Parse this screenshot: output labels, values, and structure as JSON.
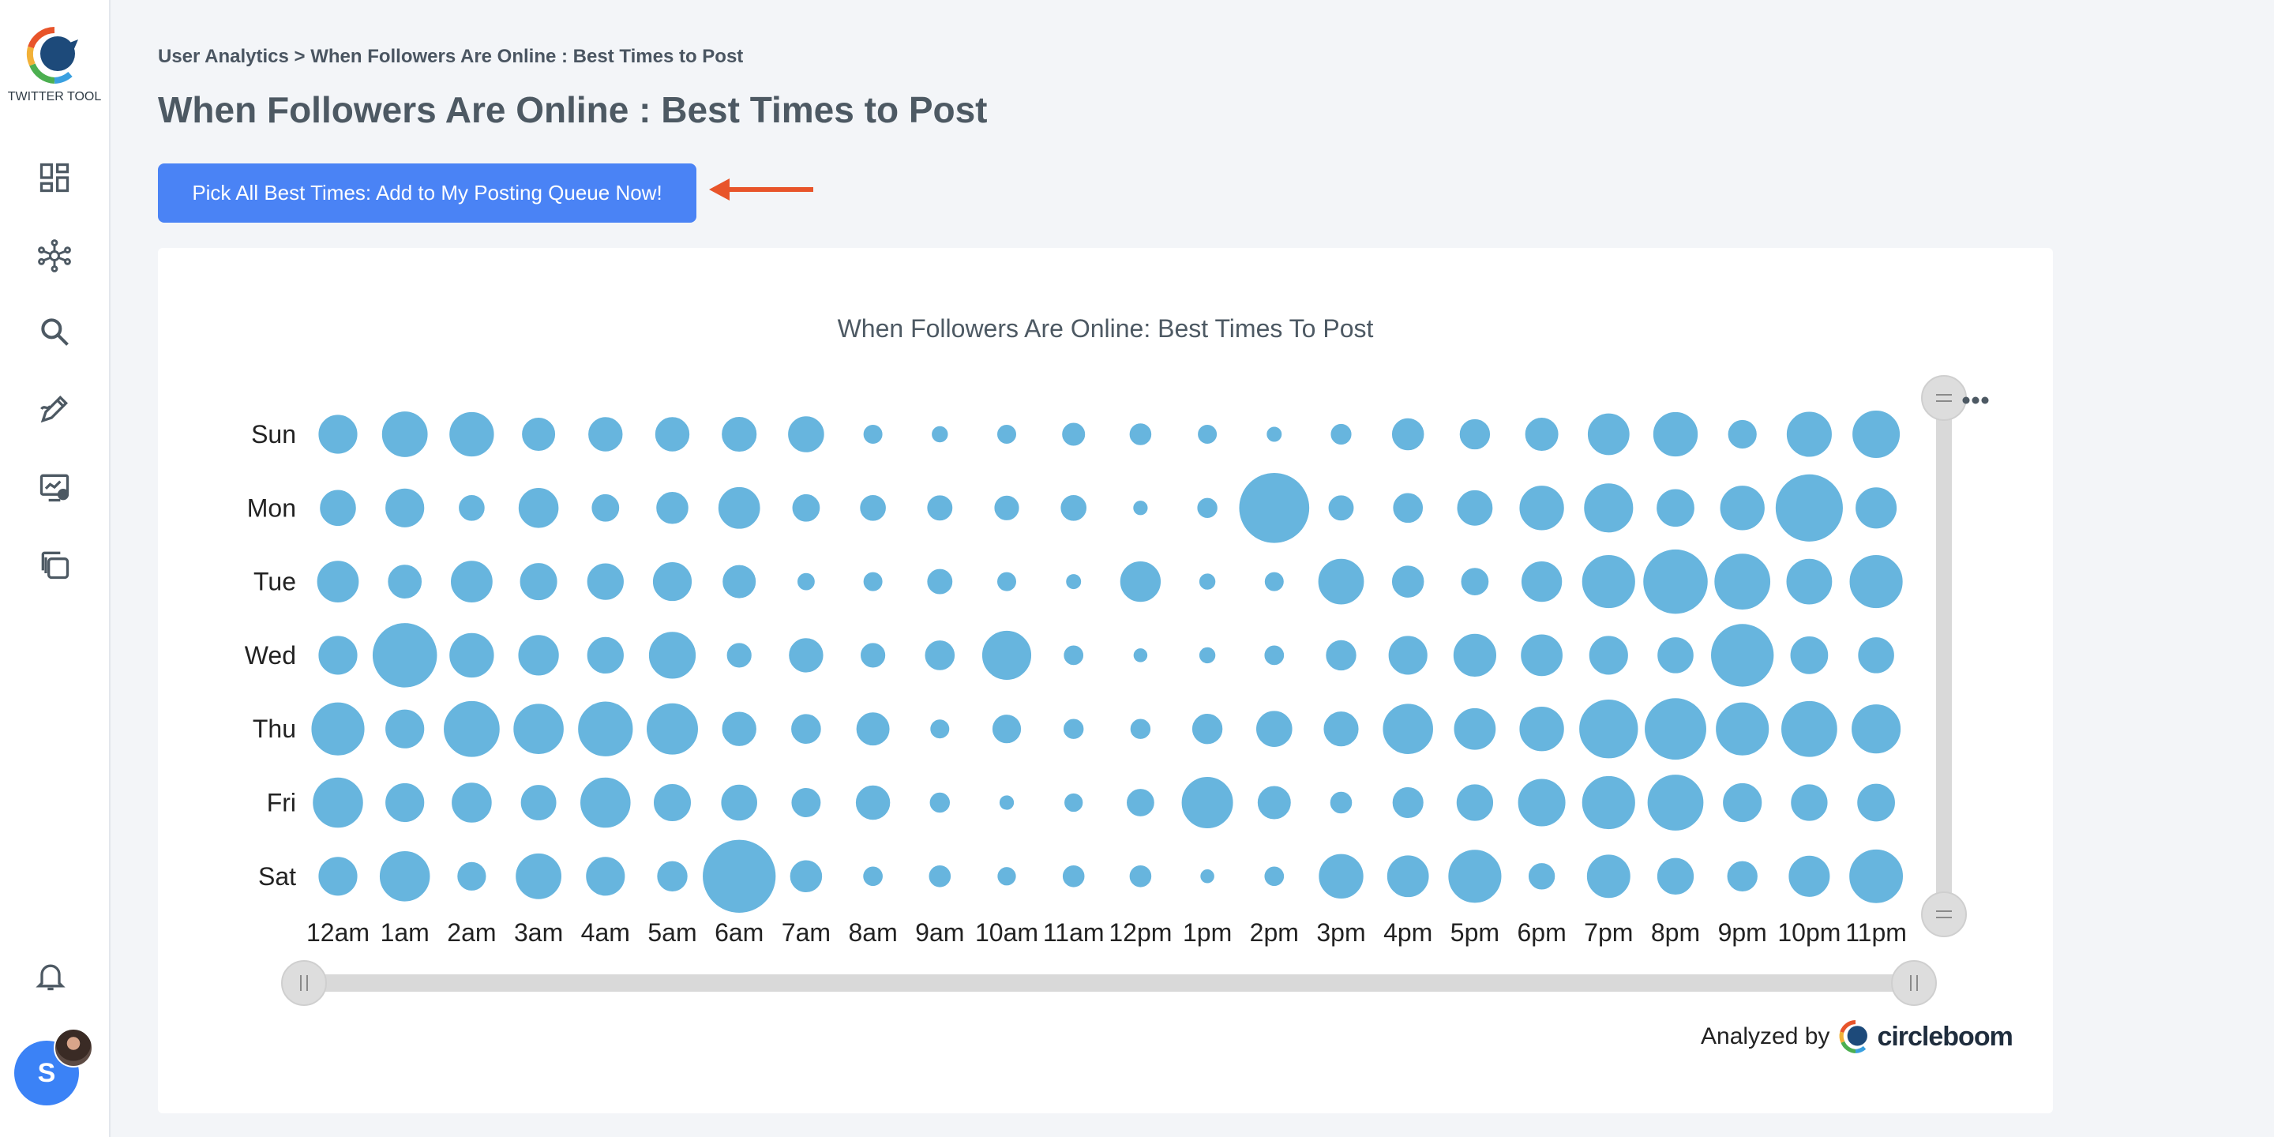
{
  "sidebar": {
    "brand": "TWITTER TOOL",
    "items": [
      {
        "icon": "dashboard-icon"
      },
      {
        "icon": "network-icon"
      },
      {
        "icon": "search-icon"
      },
      {
        "icon": "compose-icon"
      },
      {
        "icon": "analytics-icon"
      },
      {
        "icon": "copy-icon"
      }
    ],
    "notifications_icon": "bell-icon",
    "avatar_initial": "S"
  },
  "breadcrumb": "User Analytics > When Followers Are Online : Best Times to Post",
  "page_title": "When Followers Are Online : Best Times to Post",
  "cta_label": "Pick All Best Times: Add to My Posting Queue Now!",
  "footer": {
    "analyzed_by": "Analyzed by",
    "brand": "circleboom"
  },
  "colors": {
    "bubble": "#67b5de",
    "accent": "#4a83f5",
    "arrow": "#e8542a"
  },
  "chart_data": {
    "type": "scatter",
    "title": "When Followers Are Online: Best Times To Post",
    "x": [
      "12am",
      "1am",
      "2am",
      "3am",
      "4am",
      "5am",
      "6am",
      "7am",
      "8am",
      "9am",
      "10am",
      "11am",
      "12pm",
      "1pm",
      "2pm",
      "3pm",
      "4pm",
      "5pm",
      "6pm",
      "7pm",
      "8pm",
      "9pm",
      "10pm",
      "11pm"
    ],
    "y": [
      "Sun",
      "Mon",
      "Tue",
      "Wed",
      "Thu",
      "Fri",
      "Sat"
    ],
    "series": [
      {
        "values": [
          [
            0.6,
            0.72,
            0.7,
            0.5,
            0.52,
            0.52,
            0.53,
            0.55,
            0.25,
            0.2,
            0.25,
            0.32,
            0.3,
            0.25,
            0.18,
            0.28,
            0.48,
            0.45,
            0.5,
            0.65,
            0.7,
            0.42,
            0.71,
            0.75
          ],
          [
            0.55,
            0.6,
            0.37,
            0.62,
            0.4,
            0.48,
            0.65,
            0.4,
            0.37,
            0.36,
            0.35,
            0.37,
            0.17,
            0.27,
            1.15,
            0.36,
            0.44,
            0.54,
            0.7,
            0.78,
            0.58,
            0.7,
            1.1,
            0.64
          ],
          [
            0.65,
            0.51,
            0.65,
            0.57,
            0.56,
            0.6,
            0.5,
            0.22,
            0.25,
            0.36,
            0.25,
            0.18,
            0.63,
            0.2,
            0.25,
            0.72,
            0.48,
            0.4,
            0.63,
            0.85,
            1.05,
            0.9,
            0.72,
            0.85
          ],
          [
            0.6,
            1.05,
            0.7,
            0.63,
            0.56,
            0.74,
            0.35,
            0.52,
            0.35,
            0.44,
            0.78,
            0.26,
            0.16,
            0.2,
            0.26,
            0.45,
            0.6,
            0.67,
            0.65,
            0.6,
            0.55,
            1.02,
            0.58,
            0.55
          ],
          [
            0.85,
            0.6,
            0.9,
            0.8,
            0.88,
            0.82,
            0.52,
            0.44,
            0.5,
            0.25,
            0.42,
            0.27,
            0.27,
            0.45,
            0.55,
            0.53,
            0.8,
            0.65,
            0.7,
            0.95,
            1.0,
            0.85,
            0.9,
            0.78
          ],
          [
            0.8,
            0.6,
            0.62,
            0.54,
            0.8,
            0.57,
            0.55,
            0.43,
            0.52,
            0.27,
            0.17,
            0.24,
            0.4,
            0.82,
            0.5,
            0.3,
            0.46,
            0.56,
            0.75,
            0.85,
            0.9,
            0.6,
            0.56,
            0.58
          ],
          [
            0.6,
            0.8,
            0.42,
            0.72,
            0.6,
            0.45,
            1.2,
            0.48,
            0.26,
            0.3,
            0.24,
            0.3,
            0.3,
            0.16,
            0.26,
            0.7,
            0.65,
            0.85,
            0.38,
            0.68,
            0.56,
            0.45,
            0.64,
            0.86
          ]
        ]
      }
    ],
    "zoom_controls": [
      "horizontal-slider",
      "vertical-slider"
    ],
    "menu_icon": "more-options-icon"
  }
}
